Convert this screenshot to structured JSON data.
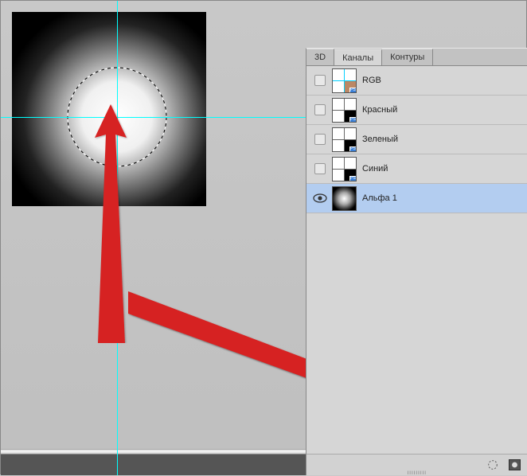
{
  "panel": {
    "tabs": [
      {
        "label": "3D",
        "active": false
      },
      {
        "label": "Каналы",
        "active": true
      },
      {
        "label": "Контуры",
        "active": false
      }
    ],
    "channels": [
      {
        "label": "RGB",
        "visible": false,
        "selected": false,
        "thumbStyle": "quad-color",
        "badge": true
      },
      {
        "label": "Красный",
        "visible": false,
        "selected": false,
        "thumbStyle": "quad-bw",
        "badge": true
      },
      {
        "label": "Зеленый",
        "visible": false,
        "selected": false,
        "thumbStyle": "quad-bw",
        "badge": true
      },
      {
        "label": "Синий",
        "visible": false,
        "selected": false,
        "thumbStyle": "quad-bw",
        "badge": true
      },
      {
        "label": "Альфа 1",
        "visible": true,
        "selected": true,
        "thumbStyle": "radial",
        "badge": false
      }
    ]
  }
}
